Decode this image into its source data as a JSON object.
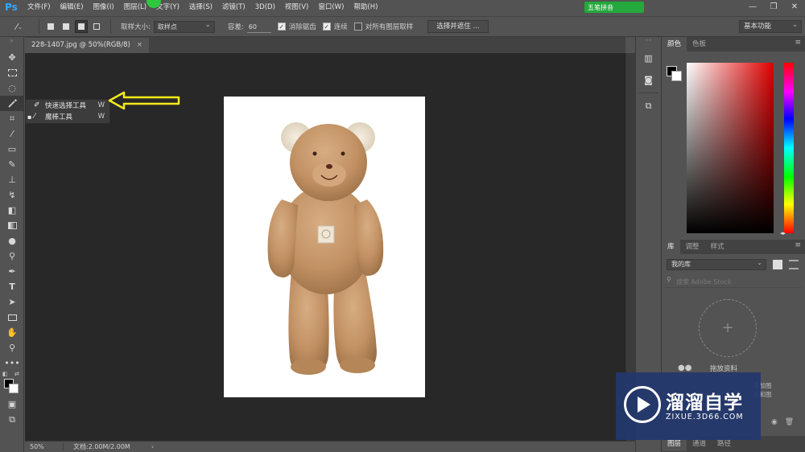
{
  "app": {
    "logo": "Ps"
  },
  "menu": [
    "文件(F)",
    "编辑(E)",
    "图像(I)",
    "图层(L)",
    "文字(Y)",
    "选择(S)",
    "滤镜(T)",
    "3D(D)",
    "视图(V)",
    "窗口(W)",
    "帮助(H)"
  ],
  "ime": {
    "label": "五笔拼音"
  },
  "window_controls": {
    "minimize": "—",
    "restore": "❐",
    "close": "✕"
  },
  "options_bar": {
    "sample_size_label": "取样大小:",
    "sample_size_value": "取样点",
    "tolerance_label": "容差:",
    "tolerance_value": "60",
    "antialias_label": "消除锯齿",
    "antialias_checked": true,
    "contiguous_label": "连续",
    "contiguous_checked": true,
    "sample_all_label": "对所有图层取样",
    "sample_all_checked": false,
    "select_mask_button": "选择并遮住 ...",
    "workspace": "基本功能"
  },
  "document": {
    "tab_title": "228-1407.jpg @ 50%(RGB/8)",
    "close_glyph": "×",
    "zoom": "50%",
    "doc_info": "文档:2.00M/2.00M"
  },
  "tool_flyout": {
    "items": [
      {
        "label": "快速选择工具",
        "shortcut": "W",
        "icon": "quick-selection-icon",
        "active": false
      },
      {
        "label": "魔棒工具",
        "shortcut": "W",
        "icon": "magic-wand-icon",
        "active": true
      }
    ]
  },
  "right_panels": {
    "color_tabs": [
      "颜色",
      "色板"
    ],
    "library_tabs": [
      "库",
      "调整",
      "样式"
    ],
    "library_select": "我的库",
    "library_search_placeholder": "搜索 Adobe Stock",
    "library_hint": "拖放资料",
    "library_side_text": [
      "添加图",
      "色和图"
    ],
    "layers_tabs": [
      "图层",
      "通道",
      "路径"
    ]
  },
  "watermark": {
    "name": "溜溜自学",
    "url": "ZIXUE.3D66.COM"
  },
  "colors": {
    "accent_ps": "#31a8ff",
    "ime_green": "#25a83c",
    "arrow_yellow": "#f3ea1b",
    "watermark_bg": "#23376e"
  }
}
